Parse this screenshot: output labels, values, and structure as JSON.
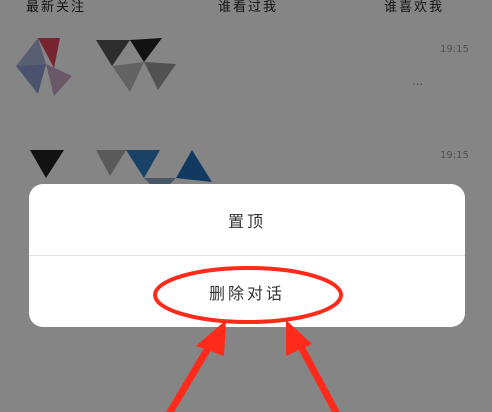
{
  "tabs": [
    "最新关注",
    "谁看过我",
    "谁喜欢我"
  ],
  "conversations": [
    {
      "time": "19:15",
      "preview": "..."
    },
    {
      "time": "19:15"
    }
  ],
  "dialog": {
    "pin_label": "置顶",
    "delete_label": "删除对话"
  },
  "colors": {
    "annotation": "#ff2a1a",
    "overlay": "rgba(0,0,0,0.47)"
  }
}
